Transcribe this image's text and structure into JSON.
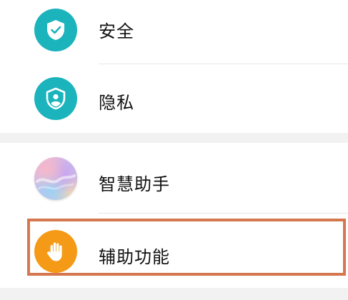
{
  "settings": {
    "items": [
      {
        "label": "安全",
        "icon": "shield-check-icon"
      },
      {
        "label": "隐私",
        "icon": "privacy-shield-icon"
      },
      {
        "label": "智慧助手",
        "icon": "assistant-gradient-icon"
      },
      {
        "label": "辅助功能",
        "icon": "hand-icon"
      }
    ]
  },
  "colors": {
    "teal_icon": "#1bb3bc",
    "orange_icon": "#f59a16",
    "highlight_border": "#d4774f",
    "group_gap": "#f2f2f2"
  }
}
